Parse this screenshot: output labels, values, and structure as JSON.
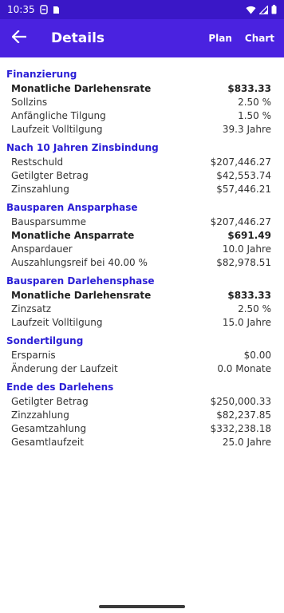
{
  "status": {
    "time": "10:35"
  },
  "app_bar": {
    "title": "Details",
    "plan_label": "Plan",
    "chart_label": "Chart"
  },
  "sections": [
    {
      "title": "Finanzierung",
      "rows": [
        {
          "label": "Monatliche Darlehensrate",
          "value": "$833.33",
          "bold": true
        },
        {
          "label": "Sollzins",
          "value": "2.50 %"
        },
        {
          "label": "Anfängliche Tilgung",
          "value": "1.50 %"
        },
        {
          "label": "Laufzeit Volltilgung",
          "value": "39.3 Jahre"
        }
      ]
    },
    {
      "title": "Nach 10 Jahren Zinsbindung",
      "rows": [
        {
          "label": "Restschuld",
          "value": "$207,446.27"
        },
        {
          "label": "Getilgter Betrag",
          "value": "$42,553.74"
        },
        {
          "label": "Zinszahlung",
          "value": "$57,446.21"
        }
      ]
    },
    {
      "title": "Bausparen Ansparphase",
      "rows": [
        {
          "label": "Bausparsumme",
          "value": "$207,446.27"
        },
        {
          "label": "Monatliche Ansparrate",
          "value": "$691.49",
          "bold": true
        },
        {
          "label": "Anspardauer",
          "value": "10.0 Jahre"
        },
        {
          "label": "Auszahlungsreif bei 40.00 %",
          "value": "$82,978.51"
        }
      ]
    },
    {
      "title": "Bausparen Darlehensphase",
      "rows": [
        {
          "label": "Monatliche Darlehensrate",
          "value": "$833.33",
          "bold": true
        },
        {
          "label": "Zinzsatz",
          "value": "2.50 %"
        },
        {
          "label": "Laufzeit Volltilgung",
          "value": "15.0 Jahre"
        }
      ]
    },
    {
      "title": "Sondertilgung",
      "rows": [
        {
          "label": "Ersparnis",
          "value": "$0.00"
        },
        {
          "label": "Änderung der Laufzeit",
          "value": "0.0 Monate"
        }
      ]
    },
    {
      "title": "Ende des Darlehens",
      "rows": [
        {
          "label": "Getilgter Betrag",
          "value": "$250,000.33"
        },
        {
          "label": "Zinzzahlung",
          "value": "$82,237.85"
        },
        {
          "label": "Gesamtzahlung",
          "value": "$332,238.18"
        },
        {
          "label": "Gesamtlaufzeit",
          "value": "25.0 Jahre"
        }
      ]
    }
  ]
}
